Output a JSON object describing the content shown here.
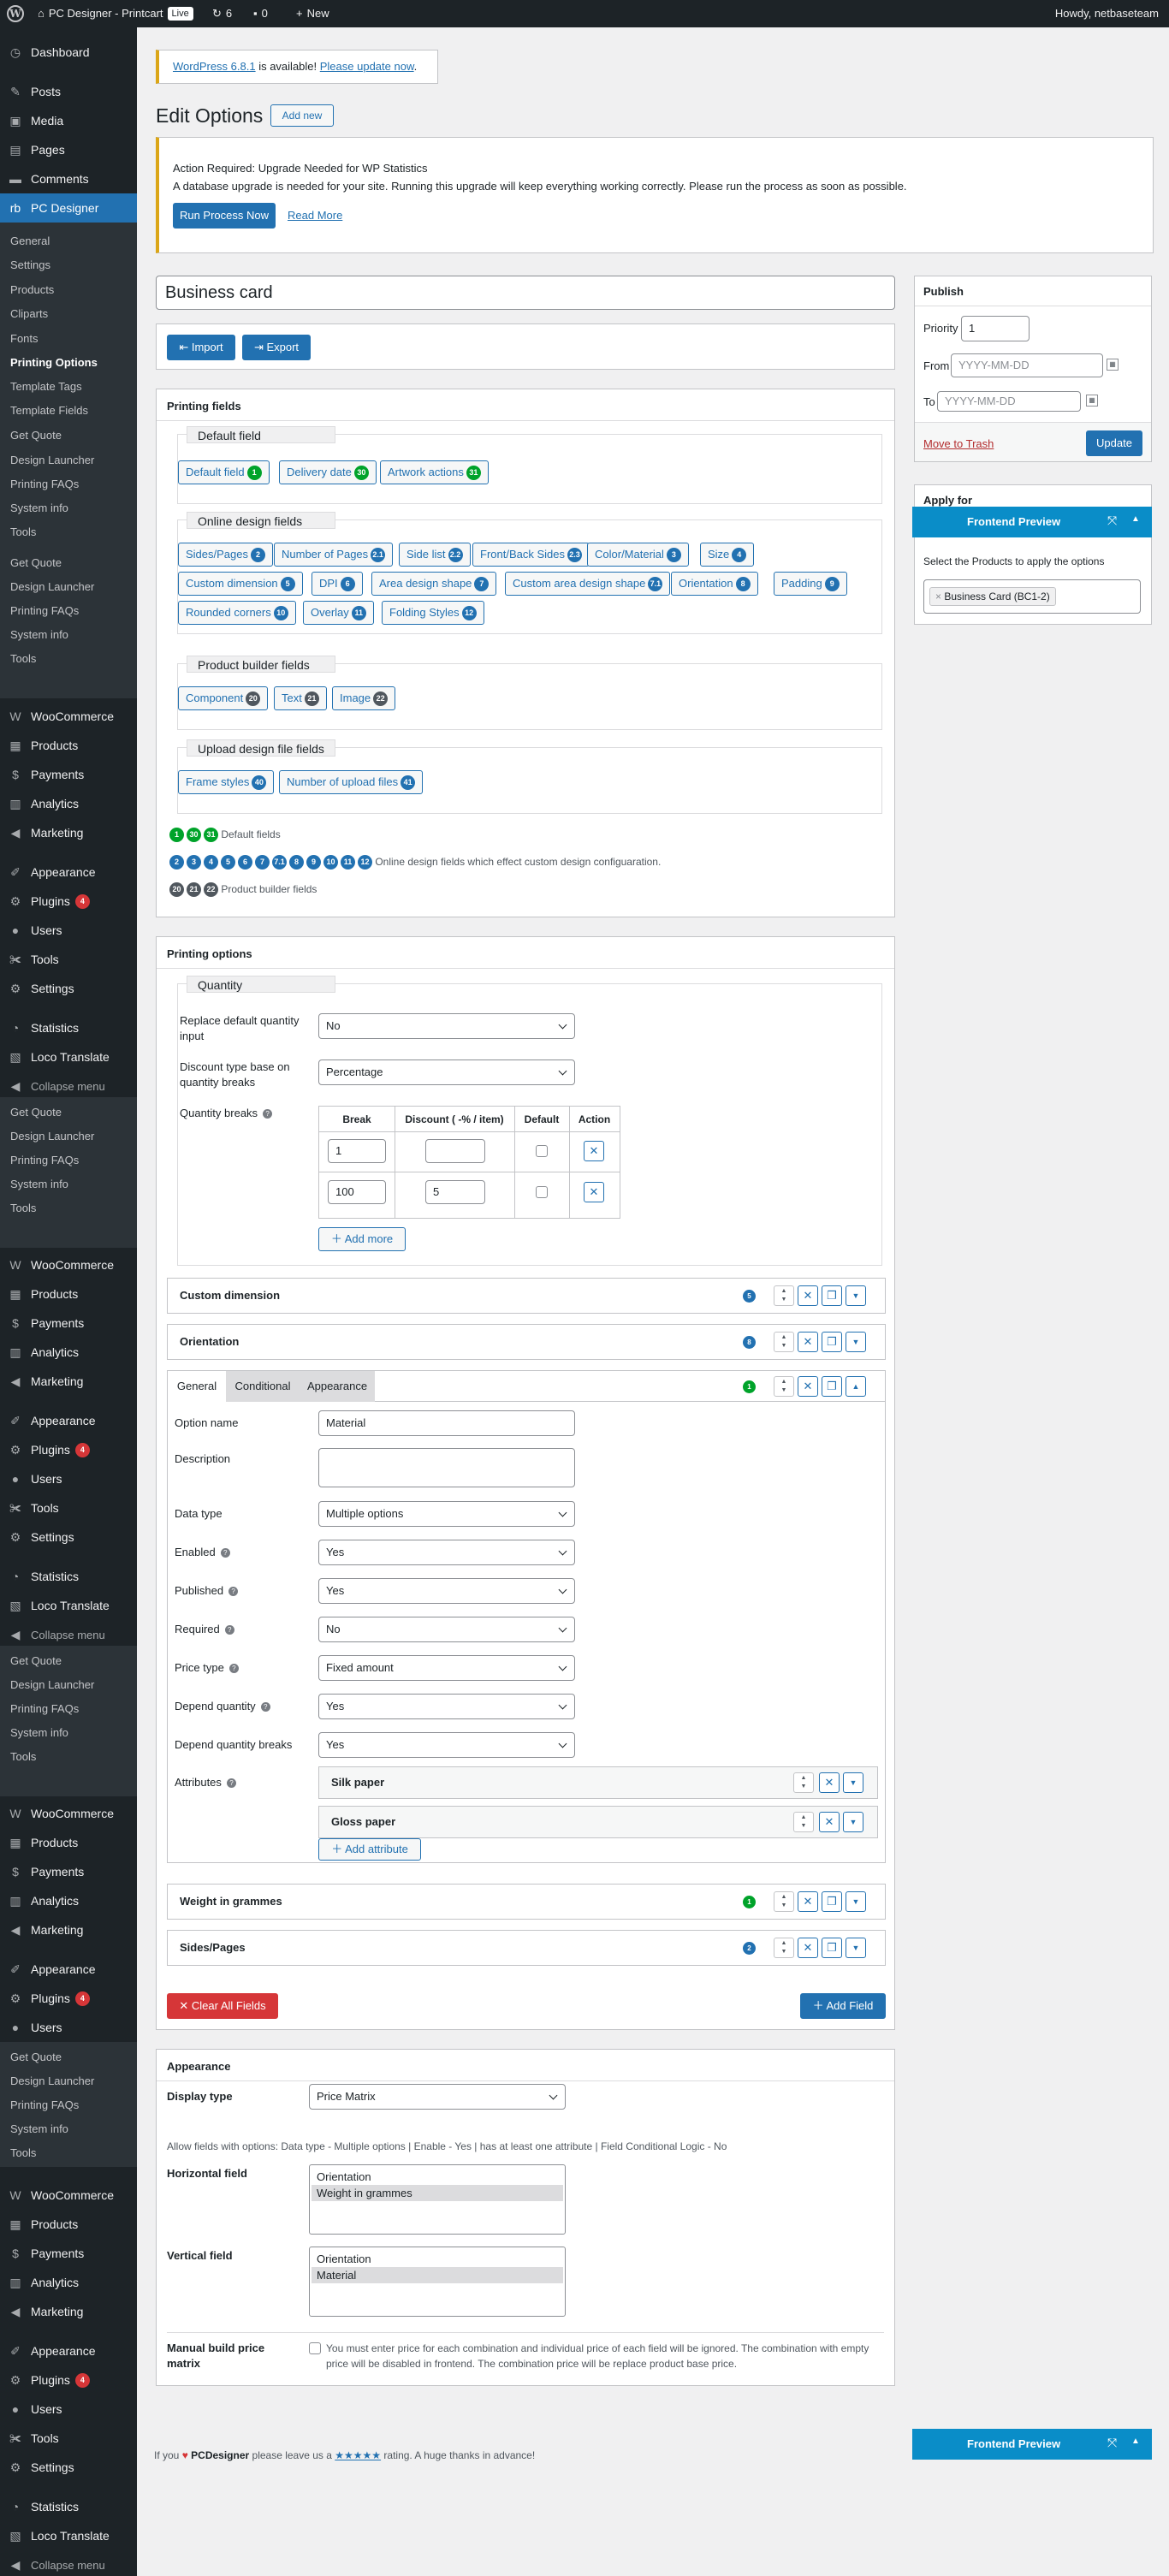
{
  "adminbar": {
    "site": "PC Designer - Printcart",
    "live": "Live",
    "updates": "6",
    "comments": "0",
    "new": "New",
    "howdy": "Howdy, netbaseteam"
  },
  "menu": {
    "dashboard": "Dashboard",
    "posts": "Posts",
    "media": "Media",
    "pages": "Pages",
    "comments": "Comments",
    "pcdesigner": "PC Designer",
    "pcd_sub": [
      "General",
      "Settings",
      "Products",
      "Cliparts",
      "Fonts",
      "Printing Options",
      "Template Tags",
      "Template Fields",
      "Get Quote",
      "Design Launcher",
      "Printing FAQs",
      "System info",
      "Tools"
    ],
    "pcd_sub2": [
      "Get Quote",
      "Design Launcher",
      "Printing FAQs",
      "System info",
      "Tools"
    ],
    "woo": "WooCommerce",
    "products": "Products",
    "payments": "Payments",
    "analytics": "Analytics",
    "marketing": "Marketing",
    "appearance": "Appearance",
    "plugins": "Plugins",
    "plugins_count": "4",
    "users": "Users",
    "tools": "Tools",
    "settings": "Settings",
    "statistics": "Statistics",
    "loco": "Loco Translate",
    "collapse": "Collapse menu"
  },
  "notice_update": {
    "link1": "WordPress 6.8.1",
    "mid": " is available! ",
    "link2": "Please update now",
    "end": "."
  },
  "page_title": "Edit Options",
  "add_new": "Add new",
  "notice_stats": {
    "title": "Action Required: Upgrade Needed for WP Statistics",
    "text": "A database upgrade is needed for your site. Running this upgrade will keep everything working correctly. Please run the process as soon as possible.",
    "run": "Run Process Now",
    "read": "Read More"
  },
  "option_title": "Business card",
  "import": "Import",
  "export": "Export",
  "printing_fields": {
    "heading": "Printing fields",
    "default_legend": "Default field",
    "default_tags": [
      {
        "label": "Default field",
        "n": "1"
      },
      {
        "label": "Delivery date",
        "n": "30"
      },
      {
        "label": "Artwork actions",
        "n": "31"
      }
    ],
    "online_legend": "Online design fields",
    "online_tags": [
      {
        "label": "Sides/Pages",
        "n": "2"
      },
      {
        "label": "Number of Pages",
        "n": "2.1"
      },
      {
        "label": "Side list",
        "n": "2.2"
      },
      {
        "label": "Front/Back Sides",
        "n": "2.3"
      },
      {
        "label": "Color/Material",
        "n": "3"
      },
      {
        "label": "Size",
        "n": "4"
      },
      {
        "label": "Custom dimension",
        "n": "5"
      },
      {
        "label": "DPI",
        "n": "6"
      },
      {
        "label": "Area design shape",
        "n": "7"
      },
      {
        "label": "Custom area design shape",
        "n": "7.1"
      },
      {
        "label": "Orientation",
        "n": "8"
      },
      {
        "label": "Padding",
        "n": "9"
      },
      {
        "label": "Rounded corners",
        "n": "10"
      },
      {
        "label": "Overlay",
        "n": "11"
      },
      {
        "label": "Folding Styles",
        "n": "12"
      }
    ],
    "builder_legend": "Product builder fields",
    "builder_tags": [
      {
        "label": "Component",
        "n": "20"
      },
      {
        "label": "Text",
        "n": "21"
      },
      {
        "label": "Image",
        "n": "22"
      }
    ],
    "upload_legend": "Upload design file fields",
    "upload_tags": [
      {
        "label": "Frame styles",
        "n": "40"
      },
      {
        "label": "Number of upload files",
        "n": "41"
      }
    ],
    "legend1_nums": [
      "1",
      "30",
      "31"
    ],
    "legend1_text": "Default fields",
    "legend2_nums": [
      "2",
      "3",
      "4",
      "5",
      "6",
      "7",
      "7.1",
      "8",
      "9",
      "10",
      "11",
      "12"
    ],
    "legend2_text": "Online design fields which effect custom design configuaration.",
    "legend3_nums": [
      "20",
      "21",
      "22"
    ],
    "legend3_text": "Product builder fields"
  },
  "printing_options": {
    "heading": "Printing options",
    "quantity_legend": "Quantity",
    "replace_label": "Replace default quantity input",
    "replace_value": "No",
    "discount_label": "Discount type base on quantity breaks",
    "discount_value": "Percentage",
    "breaks_label": "Quantity breaks",
    "cols": [
      "Break",
      "Discount ( -% / item)",
      "Default",
      "Action"
    ],
    "rows": [
      {
        "brk": "1",
        "disc": ""
      },
      {
        "brk": "100",
        "disc": "5"
      }
    ],
    "add_more": "Add more",
    "groups": [
      {
        "title": "Custom dimension",
        "n": "5"
      },
      {
        "title": "Orientation",
        "n": "8"
      }
    ],
    "material_n": "1",
    "tabs": [
      "General",
      "Conditional",
      "Appearance"
    ],
    "form": {
      "option_name_label": "Option name",
      "option_name": "Material",
      "desc_label": "Description",
      "desc": "",
      "datatype_label": "Data type",
      "datatype": "Multiple options",
      "enabled_label": "Enabled",
      "enabled": "Yes",
      "published_label": "Published",
      "published": "Yes",
      "required_label": "Required",
      "required": "No",
      "pricetype_label": "Price type",
      "pricetype": "Fixed amount",
      "depqty_label": "Depend quantity",
      "depqty": "Yes",
      "depbreaks_label": "Depend quantity breaks",
      "depbreaks": "Yes",
      "attr_label": "Attributes",
      "attrs": [
        "Silk paper",
        "Gloss paper"
      ],
      "add_attr": "Add attribute"
    },
    "groups2": [
      {
        "title": "Weight in grammes",
        "n": "1"
      },
      {
        "title": "Sides/Pages",
        "n": "2"
      }
    ],
    "clear": "Clear All Fields",
    "add_field": "Add Field"
  },
  "appearance": {
    "heading": "Appearance",
    "display_label": "Display type",
    "display_value": "Price Matrix",
    "allow_text": "Allow fields with options: Data type - Multiple options | Enable - Yes | has at least one attribute | Field Conditional Logic - No",
    "hfield_label": "Horizontal field",
    "hfield_opts": [
      "Orientation",
      "Weight in grammes"
    ],
    "vfield_label": "Vertical field",
    "vfield_opts": [
      "Orientation",
      "Material"
    ],
    "manual_label": "Manual build price matrix",
    "manual_text": "You must enter price for each combination and individual price of each field will be ignored. The combination with empty price will be disabled in frontend. The combination price will be replace product base price."
  },
  "publish": {
    "heading": "Publish",
    "priority_label": "Priority",
    "priority": "1",
    "from_label": "From",
    "to_label": "To",
    "date_ph": "YYYY-MM-DD",
    "trash": "Move to Trash",
    "update": "Update"
  },
  "apply": {
    "heading": "Apply for",
    "text": "Select the Products to apply the options",
    "chip": "Business Card (BC1-2)"
  },
  "preview": {
    "title": "Frontend Preview"
  },
  "footer": {
    "pre": "If you ",
    "heart": "♥",
    "brand": "PCDesigner",
    "mid": " please leave us a ",
    "stars": "★★★★★",
    "post": " rating. A huge thanks in advance!"
  }
}
